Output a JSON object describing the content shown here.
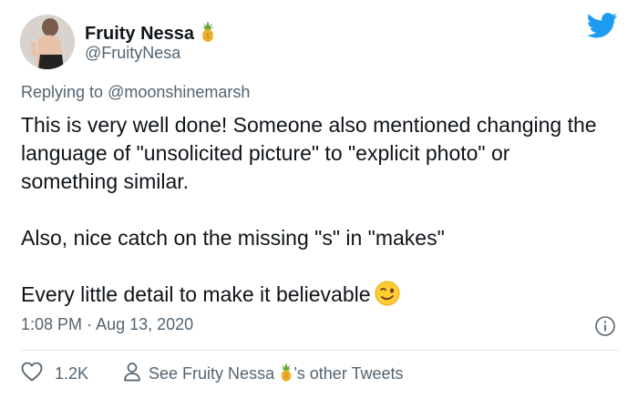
{
  "author": {
    "name": "Fruity Nessa",
    "handle": "@FruityNesa",
    "name_emoji": "pineapple-emoji"
  },
  "reply": {
    "prefix": "Replying to",
    "mention": "@moonshinemarsh"
  },
  "tweet": {
    "paragraph1": "This is very well done! Someone also mentioned changing the language of \"unsolicited picture\" to \"explicit photo\" or something similar.",
    "paragraph2": "Also, nice catch on the missing \"s\" in \"makes\"",
    "paragraph3": "Every little detail to make it believable",
    "trailing_emoji": "winking-face-emoji"
  },
  "meta": {
    "time": "1:08 PM",
    "separator": "·",
    "date": "Aug 13, 2020"
  },
  "actions": {
    "likes": "1.2K",
    "see_prefix": "See Fruity Nessa",
    "see_suffix": "’s other Tweets"
  },
  "colors": {
    "twitter_blue": "#1d9bf0",
    "secondary_text": "#536471",
    "divider": "#e1e8ed"
  }
}
